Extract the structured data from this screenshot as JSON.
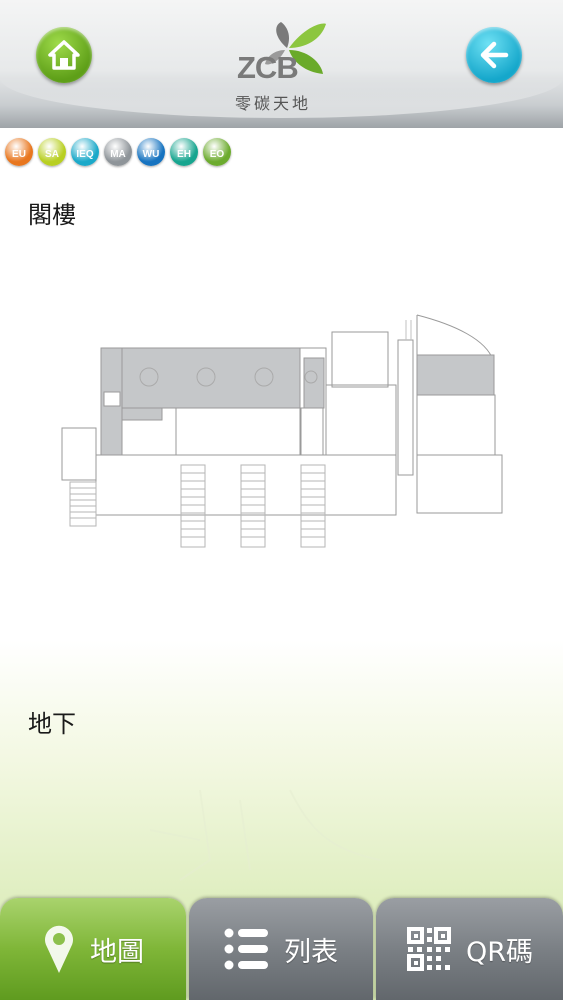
{
  "header": {
    "logo_text": "ZCB",
    "logo_subtitle": "零碳天地",
    "home_icon": "home-icon",
    "back_icon": "arrow-left-icon"
  },
  "badges": [
    {
      "code": "EU",
      "color": "#e8761e"
    },
    {
      "code": "SA",
      "color": "#b8cf22"
    },
    {
      "code": "IEQ",
      "color": "#1ba9c9"
    },
    {
      "code": "MA",
      "color": "#8e9499"
    },
    {
      "code": "WU",
      "color": "#1673c0"
    },
    {
      "code": "EH",
      "color": "#17a58f"
    },
    {
      "code": "EO",
      "color": "#6cab2e"
    }
  ],
  "sections": {
    "attic_title": "閣樓",
    "basement_title": "地下"
  },
  "tabs": {
    "map_label": "地圖",
    "list_label": "列表",
    "qr_label": "QR碼",
    "map_icon": "map-pin-icon",
    "list_icon": "list-icon",
    "qr_icon": "qr-code-icon"
  },
  "colors": {
    "green_tab": "#7fb638",
    "grey_tab": "#7b8085",
    "home_button": "#6aad1d",
    "back_button": "#1fb1d3"
  }
}
